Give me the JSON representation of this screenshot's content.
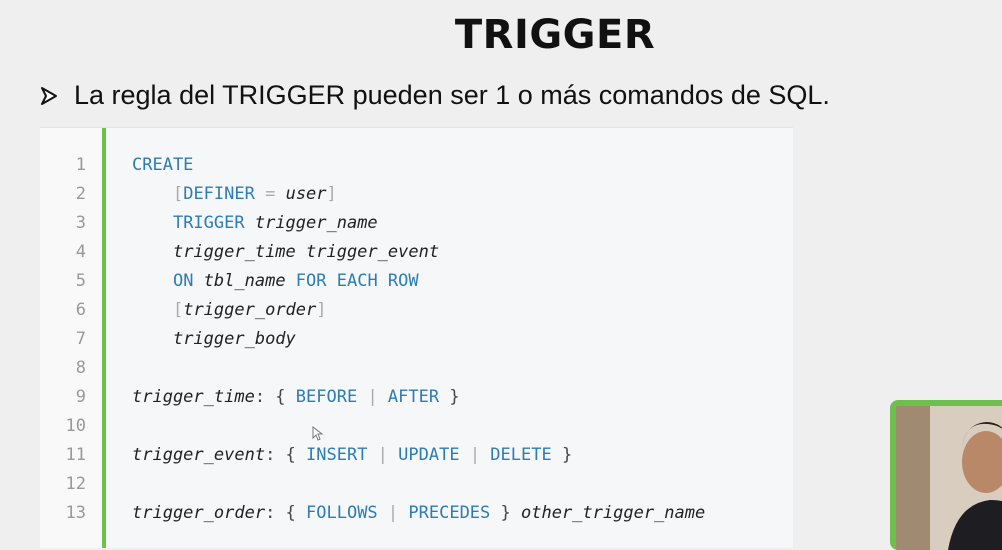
{
  "slide": {
    "title": "TRIGGER",
    "bullet": "La regla del TRIGGER pueden ser 1 o más comandos de SQL."
  },
  "code": {
    "lines": [
      {
        "n": "1",
        "tokens": [
          {
            "t": "CREATE",
            "c": "kw"
          }
        ]
      },
      {
        "n": "2",
        "tokens": [
          {
            "t": "    ",
            "c": "pu"
          },
          {
            "t": "[",
            "c": "br"
          },
          {
            "t": "DEFINER",
            "c": "kw"
          },
          {
            "t": " = ",
            "c": "br"
          },
          {
            "t": "user",
            "c": "id"
          },
          {
            "t": "]",
            "c": "br"
          }
        ]
      },
      {
        "n": "3",
        "tokens": [
          {
            "t": "    ",
            "c": "pu"
          },
          {
            "t": "TRIGGER ",
            "c": "kw"
          },
          {
            "t": "trigger_name",
            "c": "id"
          }
        ]
      },
      {
        "n": "4",
        "tokens": [
          {
            "t": "    ",
            "c": "pu"
          },
          {
            "t": "trigger_time trigger_event",
            "c": "id"
          }
        ]
      },
      {
        "n": "5",
        "tokens": [
          {
            "t": "    ",
            "c": "pu"
          },
          {
            "t": "ON ",
            "c": "kw"
          },
          {
            "t": "tbl_name",
            "c": "id"
          },
          {
            "t": " FOR EACH ROW",
            "c": "kw"
          }
        ]
      },
      {
        "n": "6",
        "tokens": [
          {
            "t": "    ",
            "c": "pu"
          },
          {
            "t": "[",
            "c": "br"
          },
          {
            "t": "trigger_order",
            "c": "id"
          },
          {
            "t": "]",
            "c": "br"
          }
        ]
      },
      {
        "n": "7",
        "tokens": [
          {
            "t": "    ",
            "c": "pu"
          },
          {
            "t": "trigger_body",
            "c": "id"
          }
        ]
      },
      {
        "n": "8",
        "tokens": []
      },
      {
        "n": "9",
        "tokens": [
          {
            "t": "trigger_time",
            "c": "id"
          },
          {
            "t": ": { ",
            "c": "pu"
          },
          {
            "t": "BEFORE",
            "c": "kw"
          },
          {
            "t": " | ",
            "c": "br"
          },
          {
            "t": "AFTER",
            "c": "kw"
          },
          {
            "t": " }",
            "c": "pu"
          }
        ]
      },
      {
        "n": "10",
        "tokens": []
      },
      {
        "n": "11",
        "tokens": [
          {
            "t": "trigger_event",
            "c": "id"
          },
          {
            "t": ": { ",
            "c": "pu"
          },
          {
            "t": "INSERT",
            "c": "kw"
          },
          {
            "t": " | ",
            "c": "br"
          },
          {
            "t": "UPDATE",
            "c": "kw"
          },
          {
            "t": " | ",
            "c": "br"
          },
          {
            "t": "DELETE",
            "c": "kw"
          },
          {
            "t": " }",
            "c": "pu"
          }
        ]
      },
      {
        "n": "12",
        "tokens": []
      },
      {
        "n": "13",
        "tokens": [
          {
            "t": "trigger_order",
            "c": "id"
          },
          {
            "t": ": { ",
            "c": "pu"
          },
          {
            "t": "FOLLOWS",
            "c": "kw"
          },
          {
            "t": " | ",
            "c": "br"
          },
          {
            "t": "PRECEDES",
            "c": "kw"
          },
          {
            "t": " } ",
            "c": "pu"
          },
          {
            "t": "other_trigger_name",
            "c": "id"
          }
        ]
      }
    ]
  },
  "icons": {
    "bullet": "arrow-bullet-icon",
    "cursor": "mouse-pointer-icon"
  },
  "colors": {
    "background": "#efefef",
    "accent_bar": "#6cc24a",
    "keyword": "#2d7cb3",
    "identifier": "#222222",
    "bracket": "#aaaaaa",
    "line_number": "#999999",
    "webcam_border": "#6dc04e"
  }
}
